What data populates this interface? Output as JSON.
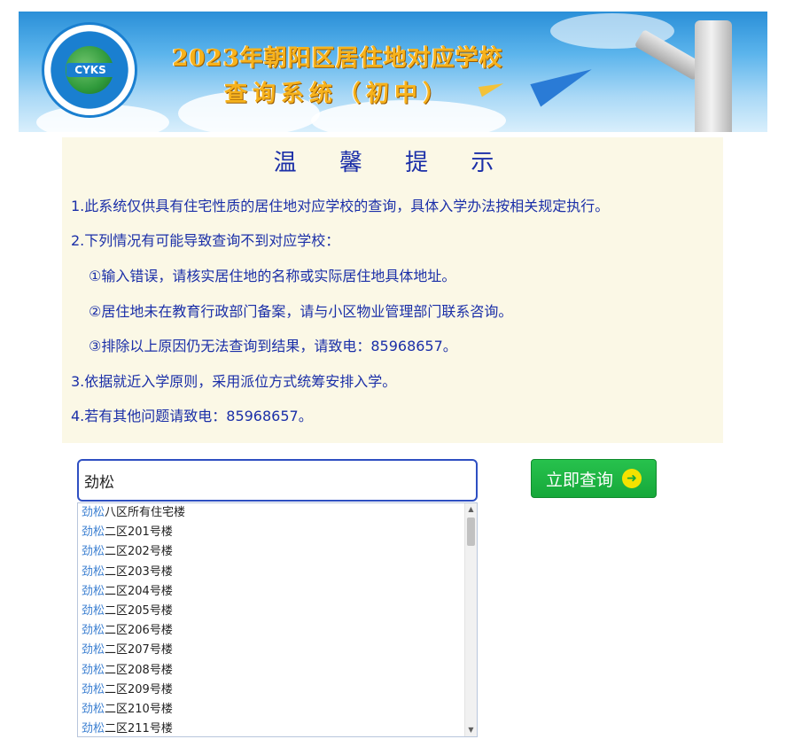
{
  "banner": {
    "logo_text": "CYKS",
    "title_line1": "2023年朝阳区居住地对应学校",
    "title_line2": "查询系统（初中）"
  },
  "notice": {
    "title": "温 馨 提 示",
    "lines": [
      "1.此系统仅供具有住宅性质的居住地对应学校的查询，具体入学办法按相关规定执行。",
      "2.下列情况有可能导致查询不到对应学校：",
      "①输入错误，请核实居住地的名称或实际居住地具体地址。",
      "②居住地未在教育行政部门备案，请与小区物业管理部门联系咨询。",
      "③排除以上原因仍无法查询到结果，请致电：85968657。",
      "3.依据就近入学原则，采用派位方式统筹安排入学。",
      "4.若有其他问题请致电：85968657。"
    ]
  },
  "search": {
    "value": "劲松",
    "button_label": "立即查询",
    "button_icon": "arrow-right-circle-icon"
  },
  "suggestions": {
    "highlight": "劲松",
    "items": [
      "八区所有住宅楼",
      "二区201号楼",
      "二区202号楼",
      "二区203号楼",
      "二区204号楼",
      "二区205号楼",
      "二区206号楼",
      "二区207号楼",
      "二区208号楼",
      "二区209号楼",
      "二区210号楼",
      "二区211号楼"
    ]
  },
  "colors": {
    "notice_text": "#1b2fa8",
    "notice_bg": "#fbf8e6",
    "button_green": "#16a83a",
    "highlight_blue": "#3b7fd1"
  }
}
